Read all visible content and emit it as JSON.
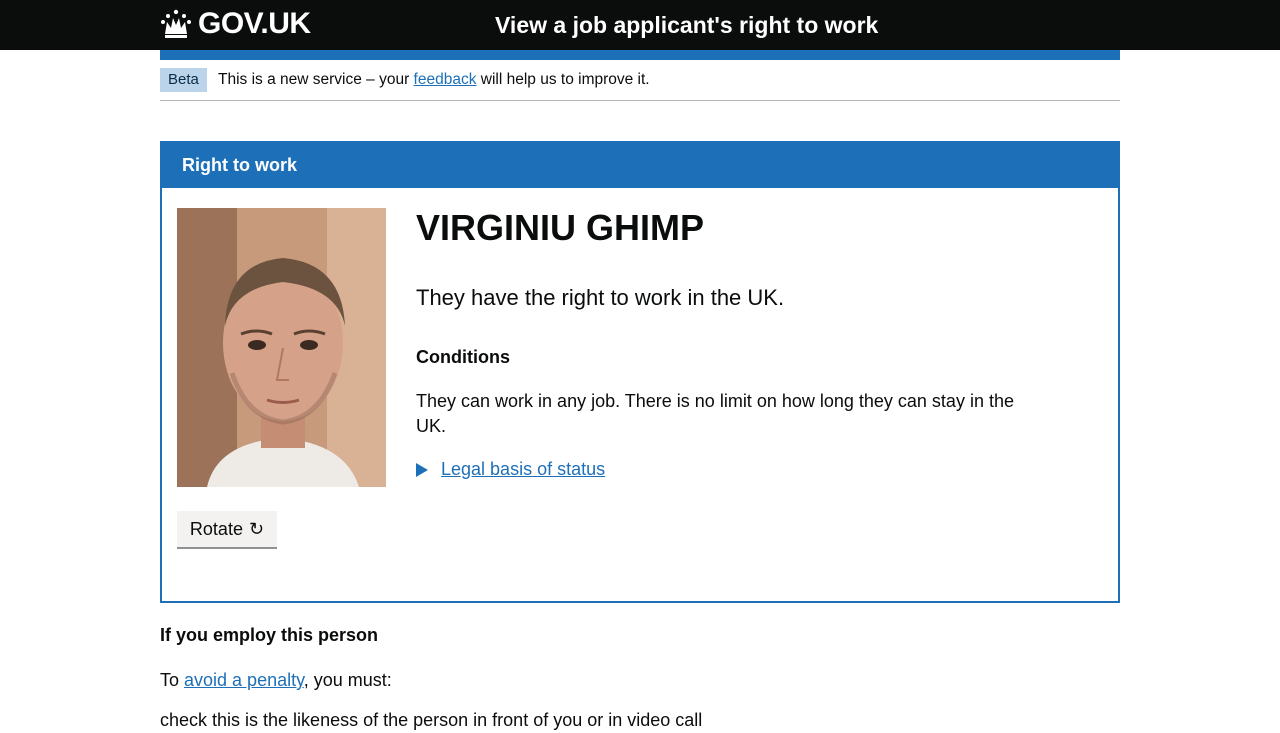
{
  "header": {
    "logo_text": "GOV.UK",
    "logo_icon": "crown-icon",
    "service_name": "View a job applicant's right to work"
  },
  "phase": {
    "tag": "Beta",
    "text_before": "This is a new service – your ",
    "link_text": "feedback",
    "text_after": " will help us to improve it."
  },
  "panel": {
    "heading": "Right to work",
    "name": "VIRGINIU GHIMP",
    "status": "They have the right to work in the UK.",
    "conditions_heading": "Conditions",
    "conditions_text": "They can work in any job. There is no limit on how long they can stay in the UK.",
    "details_label": "Legal basis of status",
    "rotate_label": "Rotate",
    "rotate_icon": "↻"
  },
  "employ": {
    "heading": "If you employ this person",
    "avoid_before": "To ",
    "avoid_link": "avoid a penalty",
    "avoid_after": ", you must:",
    "cut_off_text": "check this is the likeness of the person in front of you or in video call"
  },
  "colors": {
    "brand_blue": "#1d70b8",
    "header_black": "#0b0c0c",
    "beta_tag_bg": "#bbd4ea"
  }
}
